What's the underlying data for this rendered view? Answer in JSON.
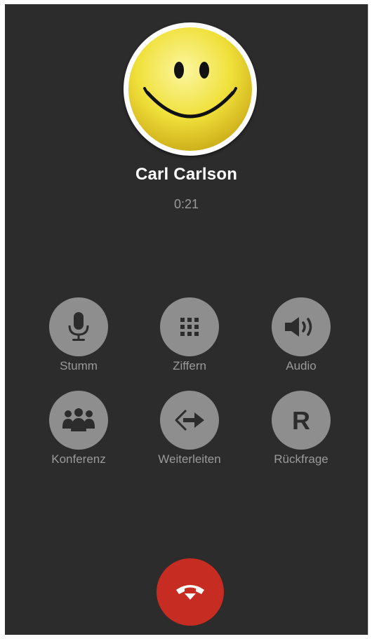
{
  "call": {
    "caller_name": "Carl Carlson",
    "duration": "0:21"
  },
  "controls": [
    {
      "label": "Stumm",
      "icon": "microphone-icon"
    },
    {
      "label": "Ziffern",
      "icon": "keypad-icon"
    },
    {
      "label": "Audio",
      "icon": "speaker-icon"
    },
    {
      "label": "Konferenz",
      "icon": "conference-icon"
    },
    {
      "label": "Weiterleiten",
      "icon": "transfer-icon"
    },
    {
      "label": "Rückfrage",
      "icon": "consultation-r-icon"
    }
  ],
  "hangup": {
    "icon": "end-call-icon"
  },
  "colors": {
    "background": "#2c2c2c",
    "control_button": "#8e8e8e",
    "control_icon": "#2c2c2c",
    "label": "#9a9a9a",
    "hangup": "#c62c22",
    "avatar_yellow": "#f2e23a"
  }
}
